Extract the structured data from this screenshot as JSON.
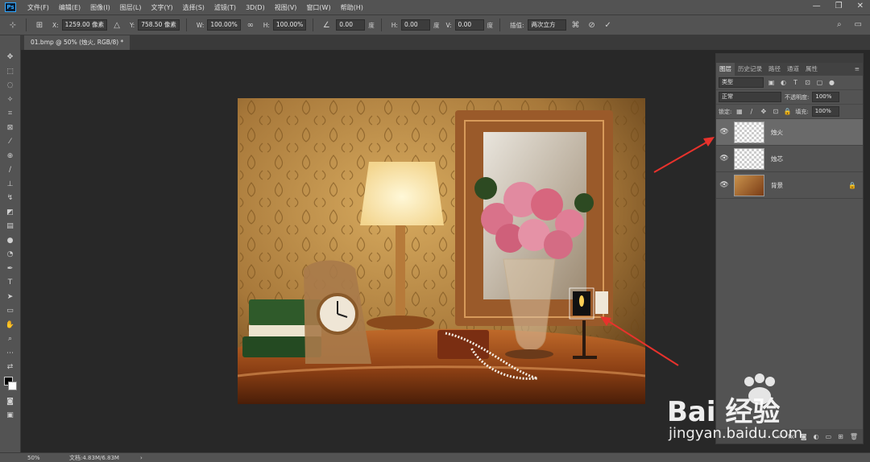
{
  "app": {
    "logo_text": "Ps"
  },
  "menu": [
    "文件(F)",
    "编辑(E)",
    "图像(I)",
    "图层(L)",
    "文字(Y)",
    "选择(S)",
    "滤镜(T)",
    "3D(D)",
    "视图(V)",
    "窗口(W)",
    "帮助(H)"
  ],
  "options": {
    "x_label": "X:",
    "x_value": "1259.00 像素",
    "y_label": "Y:",
    "y_value": "758.50 像素",
    "w_label": "W:",
    "w_value": "100.00%",
    "h_label": "H:",
    "h_value": "100.00%",
    "angle_value": "0.00",
    "angle_unit": "度",
    "hskew_label": "H:",
    "hskew_value": "0.00",
    "hskew_unit": "度",
    "vskew_label": "V:",
    "vskew_value": "0.00",
    "vskew_unit": "度",
    "interp_label": "插值:",
    "interp_value": "两次立方"
  },
  "document": {
    "tab_title": "01.bmp @ 50% (烛火, RGB/8) *"
  },
  "layers_panel": {
    "tabs": [
      "图层",
      "历史记录",
      "路径",
      "通道",
      "属性"
    ],
    "filter_type": "类型",
    "blend_mode": "正常",
    "opacity_label": "不透明度:",
    "opacity_value": "100%",
    "lock_label": "锁定:",
    "fill_label": "填充:",
    "fill_value": "100%",
    "layers": [
      {
        "name": "烛火",
        "selected": true
      },
      {
        "name": "烛芯",
        "selected": false
      },
      {
        "name": "背景",
        "selected": false,
        "locked": true
      }
    ]
  },
  "status": {
    "zoom": "50%",
    "doc_info": "文档:4.83M/6.83M",
    "arrow": "›"
  },
  "watermark": {
    "brand": "Bai 经验",
    "url": "jingyan.baidu.com"
  }
}
